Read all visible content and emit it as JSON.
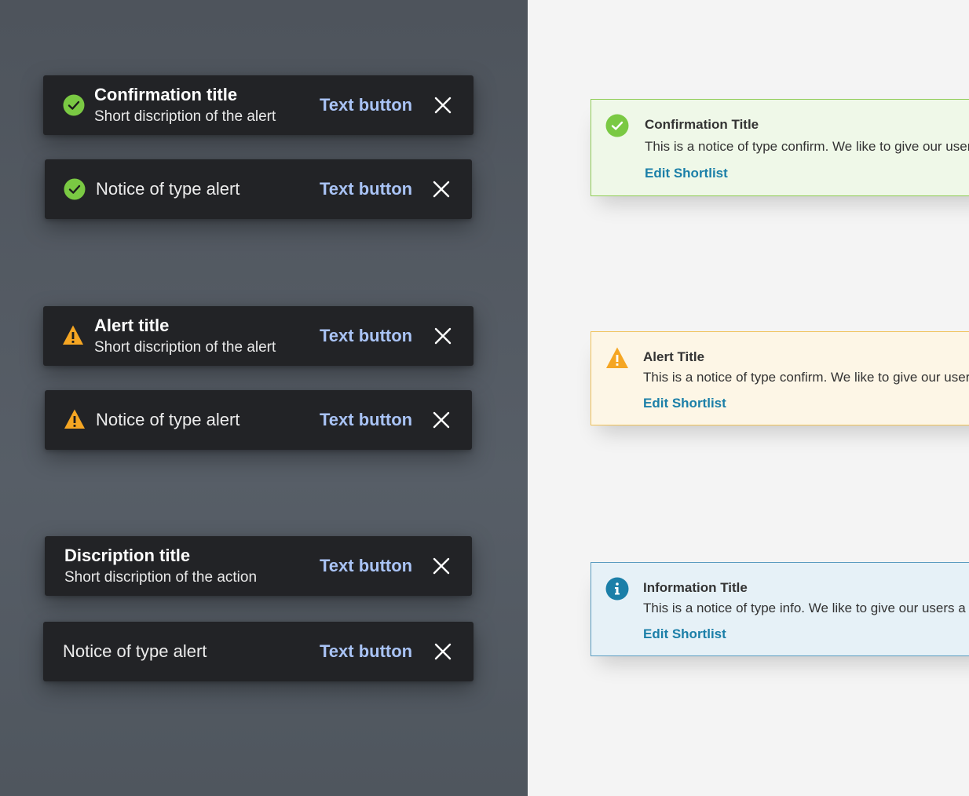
{
  "snackbars": [
    {
      "title": "Confirmation title",
      "description": "Short discription of the alert",
      "button": "Text button",
      "icon": "check-circle-icon"
    },
    {
      "message": "Notice of type alert",
      "button": "Text button",
      "icon": "check-circle-icon"
    },
    {
      "title": "Alert title",
      "description": "Short discription of the alert",
      "button": "Text button",
      "icon": "warning-triangle-icon"
    },
    {
      "message": "Notice of type alert",
      "button": "Text button",
      "icon": "warning-triangle-icon"
    },
    {
      "title": "Discription title",
      "description": "Short discription of the action",
      "button": "Text button"
    },
    {
      "message": "Notice of type alert",
      "button": "Text button"
    }
  ],
  "notices": [
    {
      "title": "Confirmation Title",
      "body": "This is a notice of type confirm. We like to give our users a heads up",
      "link": "Edit Shortlist",
      "icon": "check-circle-icon",
      "color": "#7ac943"
    },
    {
      "title": "Alert Title",
      "body": "This is a notice of type confirm. We like to give our users a heads up",
      "link": "Edit Shortlist",
      "icon": "warning-triangle-icon",
      "color": "#f5a623"
    },
    {
      "title": "Information Title",
      "body": "This is a notice of type info. We like to give our users a heads up",
      "link": "Edit Shortlist",
      "icon": "info-circle-icon",
      "color": "#1b7fa8"
    }
  ],
  "colors": {
    "snackbar_bg": "#222326",
    "text_button": "#a9c3f5",
    "success": "#7ac943",
    "warning": "#f5a623",
    "info": "#1b7fa8"
  }
}
